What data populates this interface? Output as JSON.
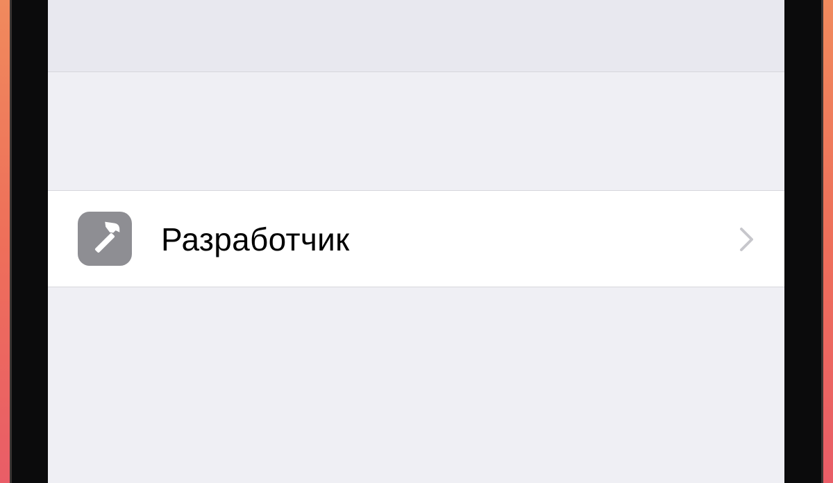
{
  "settings": {
    "developer_row": {
      "label": "Разработчик",
      "icon": "hammer-icon",
      "accessory_icon": "chevron-right-icon"
    }
  },
  "colors": {
    "screen_background": "#efeff4",
    "row_background": "#ffffff",
    "icon_background": "#8e8e93",
    "chevron": "#c7c7cc",
    "frame": "#0b0b0c",
    "backdrop_accent": "#f08a5d"
  }
}
